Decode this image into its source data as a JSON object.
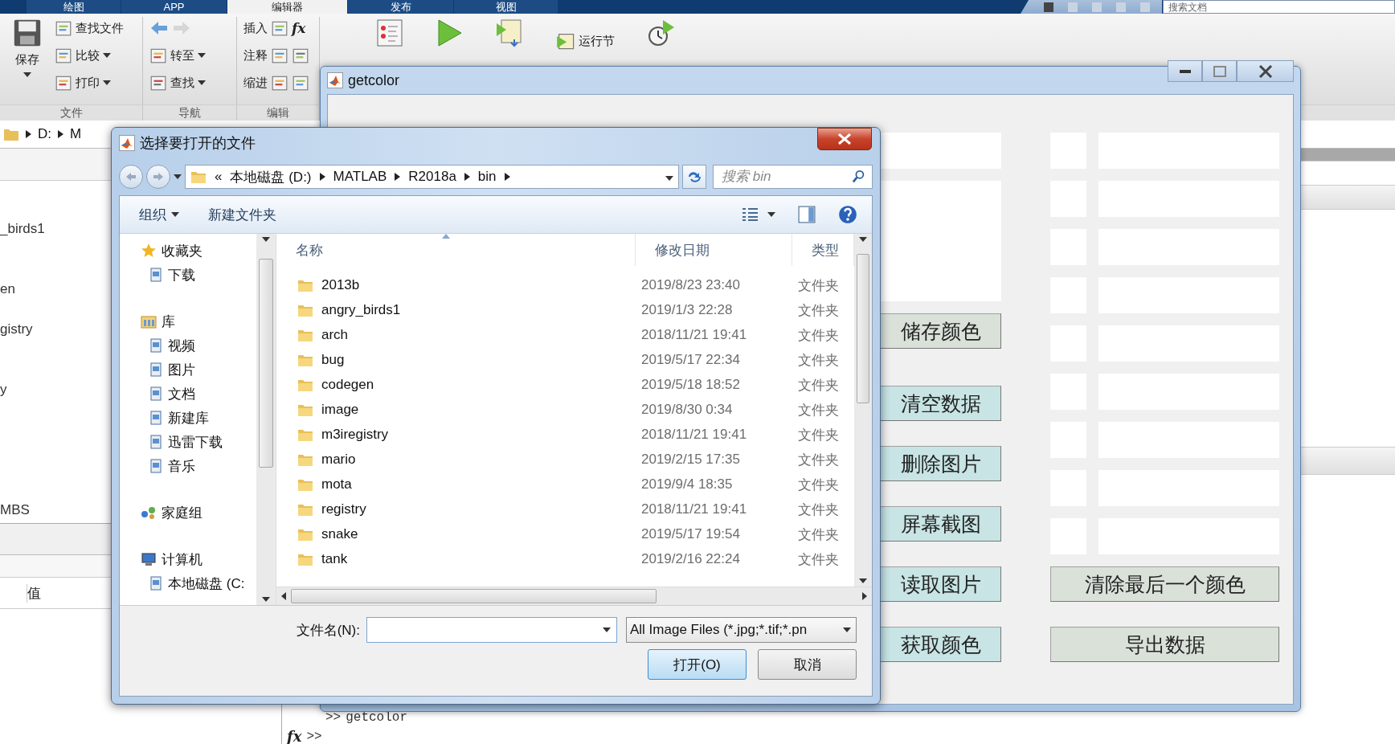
{
  "matlab": {
    "tabs": [
      {
        "label": "绘图",
        "selected": false
      },
      {
        "label": "APP",
        "selected": false
      },
      {
        "label": "编辑器",
        "selected": true
      },
      {
        "label": "发布",
        "selected": false
      },
      {
        "label": "视图",
        "selected": false
      }
    ],
    "search": {
      "placeholder": "搜索文档"
    },
    "ribbon": {
      "groups": [
        {
          "label": "文件",
          "save": "保存",
          "items": [
            {
              "label": "查找文件",
              "dropdown": false
            },
            {
              "label": "比较",
              "dropdown": true
            },
            {
              "label": "打印",
              "dropdown": true
            }
          ]
        },
        {
          "label": "导航",
          "items": [
            {
              "label": "转至",
              "dropdown": true
            },
            {
              "label": "查找",
              "dropdown": true
            }
          ]
        },
        {
          "label": "编辑",
          "function_symbol": "fx",
          "items": [
            {
              "label": "插入"
            },
            {
              "label": "注释"
            },
            {
              "label": "缩进"
            }
          ]
        }
      ],
      "run_section": "运行节"
    },
    "address": [
      "D:",
      "M"
    ],
    "folder_items": [
      "_birds1",
      "en",
      "gistry",
      "y",
      "MBS"
    ],
    "workspace_column": "值",
    "command_window": {
      "lines": [
        {
          "prompt": ">>",
          "text": "getcolor"
        }
      ],
      "input_symbol": "fx",
      "input_prompt": ">>"
    }
  },
  "figure": {
    "title": "getcolor",
    "left_buttons": [
      {
        "label": "储存颜色",
        "color": "#d9e1d9"
      },
      {
        "label": "清空数据",
        "color": "#c8e4e4"
      },
      {
        "label": "删除图片",
        "color": "#c8e4e4"
      },
      {
        "label": "屏幕截图",
        "color": "#c8e4e4"
      },
      {
        "label": "读取图片",
        "color": "#c8e4e4"
      },
      {
        "label": "获取颜色",
        "color": "#c8e4e4"
      }
    ],
    "color_slots": [
      {
        "kind": "empty"
      },
      {
        "kind": "empty"
      },
      {
        "kind": "empty"
      },
      {
        "kind": "empty"
      },
      {
        "kind": "empty"
      },
      {
        "kind": "empty"
      },
      {
        "kind": "empty"
      },
      {
        "kind": "empty"
      },
      {
        "kind": "empty"
      }
    ],
    "right_buttons": [
      {
        "label": "清除最后一个颜色",
        "color": "#d9e1d9"
      },
      {
        "label": "导出数据",
        "color": "#d9e1d9"
      }
    ]
  },
  "dialog": {
    "title": "选择要打开的文件",
    "path_prefix": "«",
    "path": [
      "本地磁盘 (D:)",
      "MATLAB",
      "R2018a",
      "bin"
    ],
    "search": {
      "placeholder": "搜索 bin"
    },
    "toolbar": [
      {
        "label": "组织",
        "dropdown": true
      },
      {
        "label": "新建文件夹",
        "dropdown": false
      }
    ],
    "nav": [
      {
        "label": "收藏夹",
        "children": [
          {
            "label": "下载"
          }
        ]
      },
      {
        "label": "库",
        "children": [
          {
            "label": "视频"
          },
          {
            "label": "图片"
          },
          {
            "label": "文档"
          },
          {
            "label": "新建库"
          },
          {
            "label": "迅雷下载"
          },
          {
            "label": "音乐"
          }
        ]
      },
      {
        "label": "家庭组"
      },
      {
        "label": "计算机",
        "children": [
          {
            "label": "本地磁盘 (C:"
          }
        ]
      }
    ],
    "columns": [
      "名称",
      "修改日期",
      "类型"
    ],
    "rows": [
      {
        "name": "2013b",
        "date": "2019/8/23 23:40",
        "type": "文件夹"
      },
      {
        "name": "angry_birds1",
        "date": "2019/1/3 22:28",
        "type": "文件夹"
      },
      {
        "name": "arch",
        "date": "2018/11/21 19:41",
        "type": "文件夹"
      },
      {
        "name": "bug",
        "date": "2019/5/17 22:34",
        "type": "文件夹"
      },
      {
        "name": "codegen",
        "date": "2019/5/18 18:52",
        "type": "文件夹"
      },
      {
        "name": "image",
        "date": "2019/8/30 0:34",
        "type": "文件夹"
      },
      {
        "name": "m3iregistry",
        "date": "2018/11/21 19:41",
        "type": "文件夹"
      },
      {
        "name": "mario",
        "date": "2019/2/15 17:35",
        "type": "文件夹"
      },
      {
        "name": "mota",
        "date": "2019/9/4 18:35",
        "type": "文件夹"
      },
      {
        "name": "registry",
        "date": "2018/11/21 19:41",
        "type": "文件夹"
      },
      {
        "name": "snake",
        "date": "2019/5/17 19:54",
        "type": "文件夹"
      },
      {
        "name": "tank",
        "date": "2019/2/16 22:24",
        "type": "文件夹"
      }
    ],
    "filename_label": "文件名(N):",
    "filter": "All Image Files (*.jpg;*.tif;*.pn",
    "buttons": [
      {
        "label": "打开(O)",
        "kind": "default"
      },
      {
        "label": "取消",
        "kind": "normal"
      }
    ]
  }
}
